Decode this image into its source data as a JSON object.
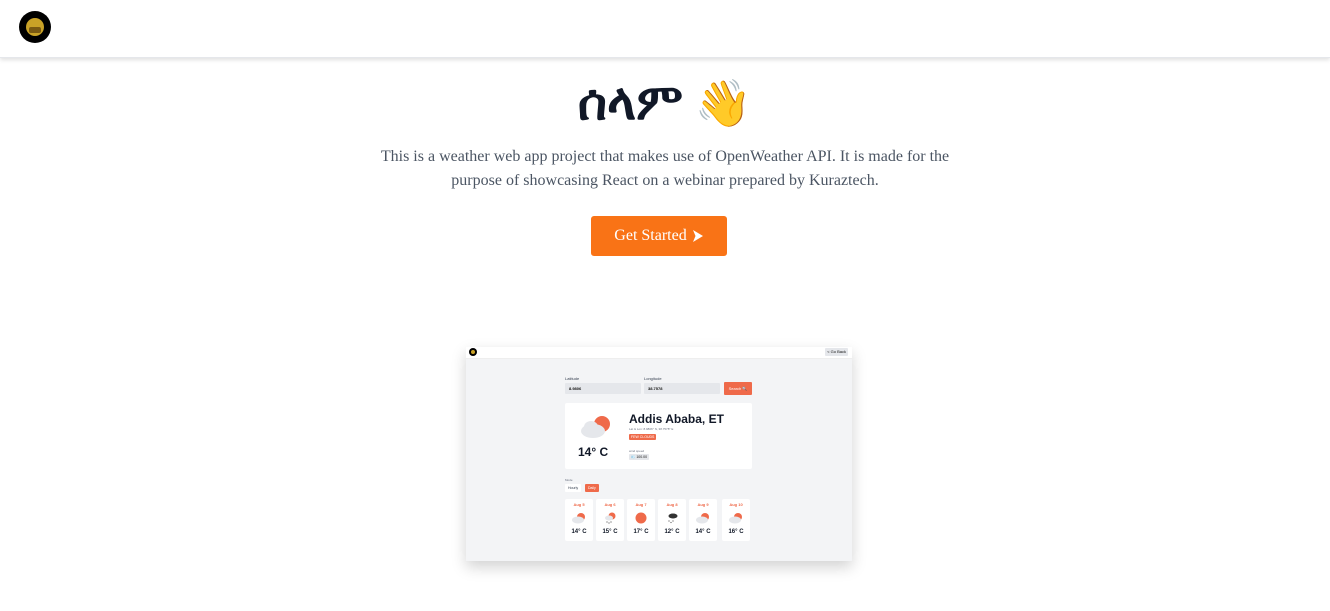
{
  "navbar": {
    "logo_icon": "kuraz-logo-icon"
  },
  "hero": {
    "title": "ሰላም",
    "wave_emoji": "👋",
    "description": "This is a weather web app project that makes use of OpenWeather API. It is made for the purpose of showcasing React on a webinar prepared by Kuraztech.",
    "cta_label": "Get Started",
    "cta_icon": "arrow-right-icon",
    "accent_color": "#f97316"
  },
  "preview": {
    "back_label": "< Go Back",
    "latitude_label": "Latitude",
    "latitude_value": "8.9806",
    "longitude_label": "Longitude",
    "longitude_value": "38.7578",
    "search_label": "Search 🔍",
    "city": "Addis Ababa, ET",
    "latlon": "Lat & Lon: 8.9806° N, 38.7578° E",
    "condition": "FEW CLOUDS",
    "wind_label": "wind speed",
    "wind_value": "💨 100.00",
    "temperature": "14° C",
    "mode_label": "Mode",
    "tabs": [
      "Hourly",
      "Daily"
    ],
    "active_tab": "Daily",
    "days": [
      {
        "date": "Aug 5",
        "temp": "14° C",
        "icon": "partly-cloudy-icon"
      },
      {
        "date": "Aug 6",
        "temp": "15° C",
        "icon": "sun-rain-icon"
      },
      {
        "date": "Aug 7",
        "temp": "17° C",
        "icon": "sun-icon"
      },
      {
        "date": "Aug 8",
        "temp": "12° C",
        "icon": "rain-cloud-icon"
      },
      {
        "date": "Aug 9",
        "temp": "14° C",
        "icon": "partly-cloudy-icon"
      },
      {
        "date": "Aug 10",
        "temp": "16° C",
        "icon": "partly-cloudy-icon"
      }
    ]
  }
}
